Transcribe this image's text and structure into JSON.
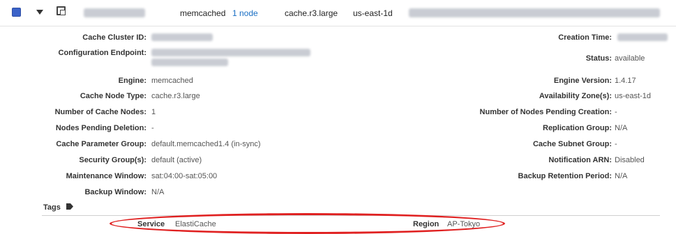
{
  "header": {
    "engine": "memcached",
    "nodes_link": "1 node",
    "node_type": "cache.r3.large",
    "zone": "us-east-1d",
    "checkbox_color": "#3b63c9"
  },
  "details_left": [
    {
      "label": "Cache Cluster ID:",
      "value": ""
    },
    {
      "label": "Configuration Endpoint:",
      "value": ""
    },
    {
      "label": "Engine:",
      "value": "memcached"
    },
    {
      "label": "Cache Node Type:",
      "value": "cache.r3.large"
    },
    {
      "label": "Number of Cache Nodes:",
      "value": "1"
    },
    {
      "label": "Nodes Pending Deletion:",
      "value": "-"
    },
    {
      "label": "Cache Parameter Group:",
      "value": "default.memcached1.4 (in-sync)"
    },
    {
      "label": "Security Group(s):",
      "value": "default (active)"
    },
    {
      "label": "Maintenance Window:",
      "value": "sat:04:00-sat:05:00"
    },
    {
      "label": "Backup Window:",
      "value": "N/A"
    }
  ],
  "details_right": [
    {
      "label": "Creation Time:",
      "value": ""
    },
    {
      "label": "Status:",
      "value": "available"
    },
    {
      "label": "Engine Version:",
      "value": "1.4.17"
    },
    {
      "label": "Availability Zone(s):",
      "value": "us-east-1d"
    },
    {
      "label": "Number of Nodes Pending Creation:",
      "value": "-"
    },
    {
      "label": "Replication Group:",
      "value": "N/A"
    },
    {
      "label": "Cache Subnet Group:",
      "value": "-"
    },
    {
      "label": "Notification ARN:",
      "value": "Disabled"
    },
    {
      "label": "Backup Retention Period:",
      "value": "N/A"
    }
  ],
  "tags": {
    "label": "Tags",
    "icon": "tag-icon",
    "items": [
      {
        "key": "Service",
        "value": "ElastiCache"
      },
      {
        "key": "Region",
        "value": "AP-Tokyo"
      }
    ],
    "highlight_color": "#e02020"
  }
}
